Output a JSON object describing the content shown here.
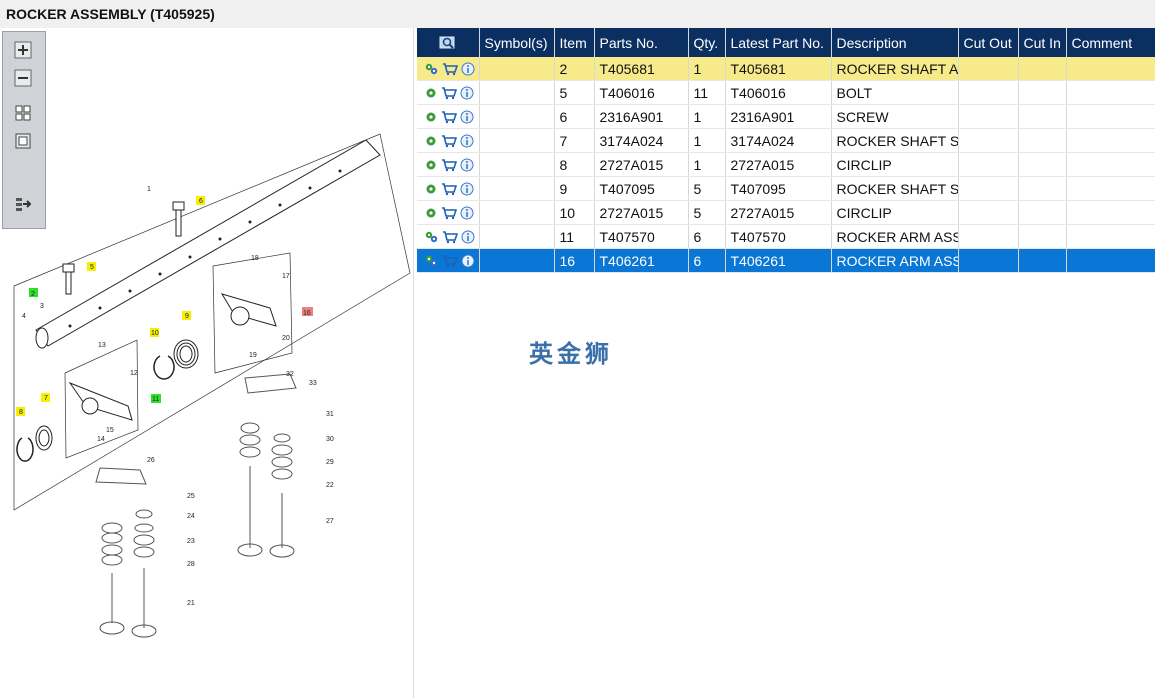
{
  "window": {
    "title": "ROCKER ASSEMBLY (T405925)"
  },
  "toolbar": {
    "buttons": [
      {
        "name": "zoom-in-button",
        "icon": "zoom-in-icon"
      },
      {
        "name": "zoom-out-button",
        "icon": "zoom-out-icon"
      },
      {
        "name": "fit-all-button",
        "icon": "fit-all-icon"
      },
      {
        "name": "fit-window-button",
        "icon": "fit-window-icon"
      },
      {
        "name": "export-button",
        "icon": "export-icon"
      }
    ]
  },
  "diagram": {
    "callouts": [
      "1",
      "2",
      "3",
      "4",
      "5",
      "6",
      "7",
      "8",
      "9",
      "10",
      "11",
      "12",
      "13",
      "14",
      "15",
      "16",
      "17",
      "18",
      "19",
      "20",
      "21",
      "22",
      "23",
      "24",
      "25",
      "26",
      "27",
      "28",
      "29",
      "30",
      "31",
      "32",
      "33"
    ],
    "highlight_yellow": [
      "5",
      "6",
      "7",
      "8",
      "9",
      "10"
    ],
    "highlight_green": [
      "2",
      "11"
    ],
    "highlight_red": [
      "16"
    ]
  },
  "grid": {
    "header_icon": "search-icon",
    "columns": [
      "Symbol(s)",
      "Item",
      "Parts No.",
      "Qty.",
      "Latest Part No.",
      "Description",
      "Cut Out",
      "Cut In",
      "Comment"
    ],
    "rows": [
      {
        "item": "2",
        "part": "T405681",
        "qty": "1",
        "latest": "T405681",
        "desc": "ROCKER SHAFT ASSEMBLY",
        "state": "yellow",
        "gear": "multi"
      },
      {
        "item": "5",
        "part": "T406016",
        "qty": "11",
        "latest": "T406016",
        "desc": "BOLT",
        "state": "",
        "gear": "single"
      },
      {
        "item": "6",
        "part": "2316A901",
        "qty": "1",
        "latest": "2316A901",
        "desc": "SCREW",
        "state": "",
        "gear": "single"
      },
      {
        "item": "7",
        "part": "3174A024",
        "qty": "1",
        "latest": "3174A024",
        "desc": "ROCKER SHAFT SPRING",
        "state": "",
        "gear": "single"
      },
      {
        "item": "8",
        "part": "2727A015",
        "qty": "1",
        "latest": "2727A015",
        "desc": "CIRCLIP",
        "state": "",
        "gear": "single"
      },
      {
        "item": "9",
        "part": "T407095",
        "qty": "5",
        "latest": "T407095",
        "desc": "ROCKER SHAFT SPRING",
        "state": "",
        "gear": "single"
      },
      {
        "item": "10",
        "part": "2727A015",
        "qty": "5",
        "latest": "2727A015",
        "desc": "CIRCLIP",
        "state": "",
        "gear": "single"
      },
      {
        "item": "11",
        "part": "T407570",
        "qty": "6",
        "latest": "T407570",
        "desc": "ROCKER ARM ASSEMBLY",
        "state": "",
        "gear": "multi"
      },
      {
        "item": "16",
        "part": "T406261",
        "qty": "6",
        "latest": "T406261",
        "desc": "ROCKER ARM ASSEMBLY",
        "state": "blue",
        "gear": "multi"
      }
    ]
  },
  "watermark": "英金狮",
  "colors": {
    "header": "#0b2f61",
    "selected": "#0a77d6",
    "highlight": "#f7ea8a"
  }
}
